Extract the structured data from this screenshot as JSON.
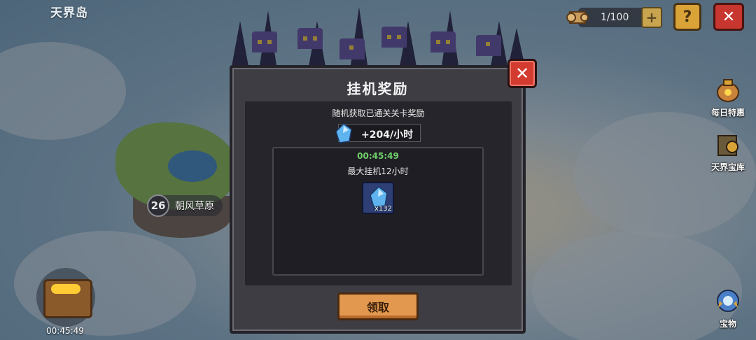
{
  "map": {
    "region_title": "天界岛",
    "stage_number": "26",
    "stage_name": "朝风草原",
    "chest_timer": "00:45:49"
  },
  "top_bar": {
    "resource_count": "1/100",
    "plus_label": "+",
    "help_label": "?",
    "close_label": "✕"
  },
  "side_menu": [
    {
      "label": "每日特惠",
      "icon": "gift-bag-icon"
    },
    {
      "label": "天界宝库",
      "icon": "treasure-vault-icon"
    },
    {
      "label": "宝物",
      "icon": "treasure-orb-icon"
    }
  ],
  "dialog": {
    "title": "挂机奖励",
    "close_label": "✕",
    "description": "随机获取已通关关卡奖励",
    "rate": "+204/小时",
    "elapsed": "00:45:49",
    "max_hint": "最大挂机12小时",
    "reward": {
      "icon": "blue-crystal-icon",
      "quantity": "x132"
    },
    "claim_label": "领取"
  },
  "colors": {
    "panel": "#3f3d44",
    "claim_button": "#e2994f",
    "close_button": "#d43b30",
    "timer_green": "#6fd06a"
  }
}
